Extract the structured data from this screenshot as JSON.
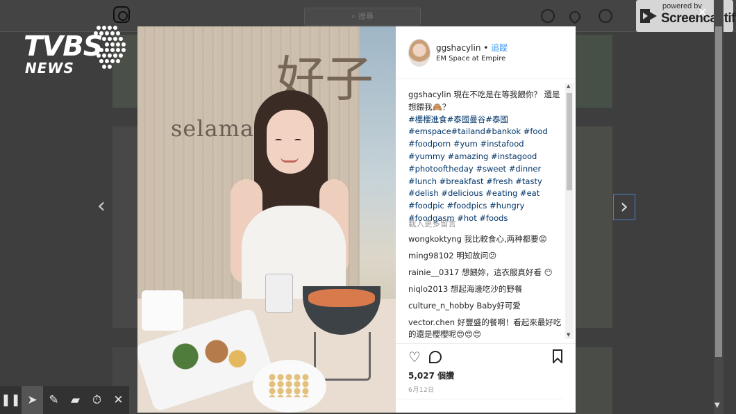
{
  "background": {
    "search_placeholder": "搜尋",
    "search_icon": "magnifier-icon",
    "prev_arrow": "‹",
    "next_arrow": "›"
  },
  "logo": {
    "brand": "TVBS",
    "sub": "NEWS"
  },
  "screencastify": {
    "small": "powered by",
    "big": "Screencastify",
    "close": "✕"
  },
  "photo": {
    "wall_text": "selamat pagi",
    "wall_char": "好子"
  },
  "post": {
    "username": "ggshacylin",
    "separator": " • ",
    "follow_label": "追蹤",
    "location": "EM Space at Empire",
    "caption_user": "ggshacylin",
    "caption_text": " 現在不吃是在等我餵你？ 還是想餵我🙈？",
    "caption_tags": "#櫻櫻進食#泰國曼谷#泰國 #emspace#tailand#bankok #food #foodporn #yum #instafood #yummy #amazing #instagood #photooftheday #sweet #dinner #lunch #breakfast #fresh #tasty #delish #delicious #eating #eat #foodpic #foodpics #hungry #foodgasm #hot #foods",
    "load_more": "載入更多留言",
    "comments": [
      {
        "user": "wongkoktyng",
        "text": " 我比較食心,两种都要😡"
      },
      {
        "user": "ming98102",
        "text": " 明知故问😕"
      },
      {
        "user": "rainie__0317",
        "text": " 想餵妳，這衣服真好看 😶"
      },
      {
        "user": "niqlo2013",
        "text": " 想起海邊吃沙的野餐"
      },
      {
        "user": "culture_n_hobby",
        "text": " Baby好可愛"
      },
      {
        "user": "vector.chen",
        "text": " 好豐盛的餐啊！看起來最好吃的還是櫻櫻呢😍😍😍"
      }
    ],
    "likes": "5,027 個讚",
    "date": "6月12日"
  },
  "recorder": {
    "pause": "❚❚",
    "pointer": "➤",
    "pen": "✎",
    "eraser": "▰",
    "timer": "⏱",
    "close": "✕"
  }
}
